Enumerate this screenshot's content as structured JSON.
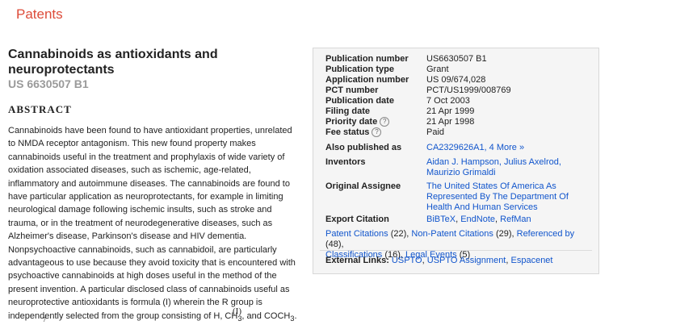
{
  "brand": "Patents",
  "patent": {
    "title": "Cannabinoids as antioxidants and neuroprotectants",
    "number": "US 6630507 B1"
  },
  "abstract": {
    "heading": "ABSTRACT",
    "text_main": "Cannabinoids have been found to have antioxidant properties, unrelated to NMDA receptor antagonism. This new found property makes cannabinoids useful in the treatment and prophylaxis of wide variety of oxidation associated diseases, such as ischemic, age-related, inflammatory and autoimmune diseases. The cannabinoids are found to have particular application as neuroprotectants, for example in limiting neurological damage following ischemic insults, such as stroke and trauma, or in the treatment of neurodegenerative diseases, such as Alzheimer's disease, Parkinson's disease and HIV dementia. Nonpsychoactive cannabinoids, such as cannabidoil, are particularly advantageous to use because they avoid toxicity that is encountered with psychoactive cannabinoids at high doses useful in the method of the present invention. A particular disclosed class of cannabinoids useful as neuroprotective antioxidants is formula (I) wherein the R group is independently selected from the group consisting of H, CH",
    "sub1": "3",
    "text_mid": ", and COCH",
    "sub2": "3",
    "text_end": ".",
    "formula_label": "(I)",
    "figure_number": "7"
  },
  "details": {
    "publication_number_label": "Publication number",
    "publication_number": "US6630507 B1",
    "publication_type_label": "Publication type",
    "publication_type": "Grant",
    "application_number_label": "Application number",
    "application_number": "US 09/674,028",
    "pct_number_label": "PCT number",
    "pct_number": "PCT/US1999/008769",
    "publication_date_label": "Publication date",
    "publication_date": "7 Oct 2003",
    "filing_date_label": "Filing date",
    "filing_date": "21 Apr 1999",
    "priority_date_label": "Priority date",
    "priority_date": "21 Apr 1998",
    "fee_status_label": "Fee status",
    "fee_status": "Paid",
    "help_glyph": "?",
    "also_published_label": "Also published as",
    "also_published": "CA2329626A1, 4 More »",
    "inventors_label": "Inventors",
    "inventors": "Aidan J. Hampson, Julius Axelrod, Maurizio Grimaldi",
    "assignee_label": "Original Assignee",
    "assignee": "The United States Of America As Represented By The Department Of Health And Human Services",
    "export_label": "Export Citation",
    "export_bibtex": "BiBTeX",
    "export_endnote": "EndNote",
    "export_refman": "RefMan",
    "sep_comma": ", "
  },
  "citations": {
    "patent_citations": "Patent Citations",
    "patent_citations_count": " (22), ",
    "non_patent_citations": "Non-Patent Citations",
    "non_patent_citations_count": " (29), ",
    "referenced_by": "Referenced by",
    "referenced_by_count": " (48),",
    "classifications": "Classifications",
    "classifications_count": " (16), ",
    "legal_events": "Legal Events",
    "legal_events_count": " (5)"
  },
  "external_links": {
    "label": "External Links:",
    "uspto": "USPTO",
    "uspto_assignment": "USPTO Assignment",
    "espacenet": "Espacenet",
    "sep": ", "
  }
}
